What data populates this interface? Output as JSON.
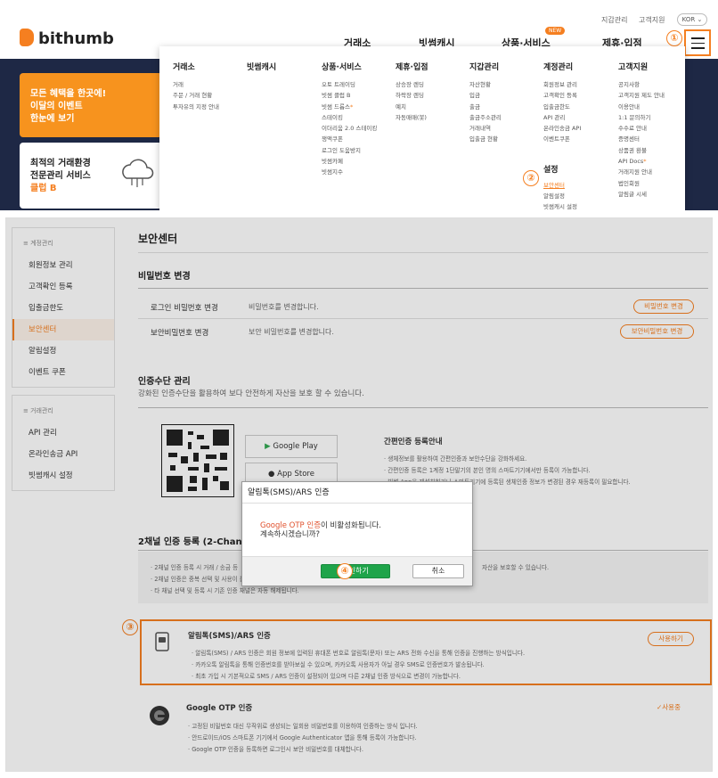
{
  "header": {
    "logo": "bithumb",
    "top_links": [
      "지갑관리",
      "고객지원"
    ],
    "lang": "KOR ⌄",
    "nav": [
      "거래소",
      "빗썸캐시",
      "상품·서비스",
      "제휴·입점"
    ],
    "new_badge": "NEW"
  },
  "markers": {
    "m1": "①",
    "m2": "②",
    "m3": "③",
    "m4": "④"
  },
  "banner": {
    "card1": [
      "모든 혜택을 한곳에!",
      "이달의 이벤트",
      "한눈에 보기"
    ],
    "card2": [
      "최적의 거래환경",
      "전문관리 서비스",
      "클럽 B"
    ]
  },
  "megamenu": [
    {
      "title": "거래소",
      "items": [
        "거래",
        "주문 / 거래 현황",
        "투자유의 지정 안내"
      ]
    },
    {
      "title": "빗썸캐시",
      "items": []
    },
    {
      "title": "상품·서비스",
      "items": [
        "오토 트레이딩",
        "빗썸 클럽 B",
        "빗썸 드롭스",
        "스테이킹",
        "이더리움 2.0 스테이킹",
        "쟁액쿠폰",
        "로그인 도움방지",
        "빗썸카페",
        "빗썸지수"
      ]
    },
    {
      "title": "제휴·입점",
      "items": [
        "상승장 렌딩",
        "하락장 렌딩",
        "예치",
        "자동매매(봇)"
      ]
    },
    {
      "title": "지갑관리",
      "items": [
        "자산현황",
        "입금",
        "출금",
        "출금주소관리",
        "거래내역",
        "입출금 현황"
      ]
    },
    {
      "title": "계정관리",
      "items": [
        "회원정보 관리",
        "고객확인 등록",
        "입출금한도",
        "API 관리",
        "온라인송금 API",
        "이벤트쿠폰"
      ],
      "sub_title": "설정",
      "sub_items": [
        "보안센터",
        "알림설정",
        "빗썸캐시 설정"
      ]
    },
    {
      "title": "고객지원",
      "items": [
        "공지사항",
        "고객지원 제도 안내",
        "이용안내",
        "1:1 문의하기",
        "수수료 안내",
        "증명센터",
        "상품권 환불",
        "API Docs",
        "거래지원 안내",
        "법인회원",
        "알림글 시세"
      ]
    }
  ],
  "sidebar": {
    "group1": {
      "title": "≡ 계정관리",
      "items": [
        "회원정보 관리",
        "고객확인 등록",
        "입출금한도",
        "보안센터",
        "알림설정",
        "이벤트 쿠폰"
      ]
    },
    "group2": {
      "title": "≡ 거래관리",
      "items": [
        "API 관리",
        "온라인송금 API",
        "빗썸캐시 설정"
      ]
    }
  },
  "page": {
    "title": "보안센터",
    "password": {
      "title": "비밀번호 변경",
      "rows": [
        {
          "label": "로그인 비밀번호 변경",
          "desc": "비밀번호를 변경합니다.",
          "btn": "비밀번호 변경"
        },
        {
          "label": "보안비밀번호 변경",
          "desc": "보안 비밀번호를 변경합니다.",
          "btn": "보안비밀번호 변경"
        }
      ]
    },
    "auth": {
      "title": "인증수단 관리",
      "desc": "강화된 인증수단을 활용하여 보다 안전하게 자산을 보호 할 수 있습니다.",
      "google_play": "Google Play",
      "app_store": "App Store",
      "easy_title": "간편인증 등록안내",
      "easy_bullets": [
        "· 생체정보를 활용하여 간편인증과 보안수단을 강화하세요.",
        "· 간편인증 등록은 1계정 1단말기의 본인 명의 스마트기기에서만 등록이 가능합니다.",
        "· 빗썸 App을 재설치하거나 스마트기기에 등록된 생체인증 정보가 변경된 경우 재등록이 필요합니다."
      ]
    },
    "twofactor": {
      "title": "2채널 인증 등록 (2-Channel V",
      "bullets": [
        "· 2채널 인증 등록 시 거래 / 송금 등",
        "· 2채널 인증은 중복 선택 및 사용이 불",
        "· 타 채널 선택 및 등록 시 기존 인증 채널은 자동 해제됩니다."
      ],
      "bullet_tail": "자산을 보호할 수 있습니다."
    },
    "sms": {
      "title": "알림톡(SMS)/ARS 인증",
      "btn": "사용하기",
      "bullets": [
        "· 알림톡(SMS) / ARS 인증은 회원 정보에 입력된 휴대폰 번호로 알림톡(문자) 또는 ARS 전화 수신을 통해 인증을 진행하는 방식입니다.",
        "· 카카오톡 알림톡을 통해 인증번호를 받아보실 수 있으며, 카카오톡 사용자가 아닐 경우 SMS로 인증번호가 발송됩니다.",
        "· 최초 가입 시 기본적으로 SMS / ARS 인증이 설정되어 있으며 다른 2채널 인증 방식으로 변경이 가능합니다."
      ]
    },
    "otp": {
      "title": "Google OTP 인증",
      "status": "✓사용중",
      "bullets": [
        "· 고정된 비밀번호 대신 무작위로 생성되는 일회용 비밀번호를 이용하여 인증하는 방식 입니다.",
        "· 안드로이드/iOS 스마트폰 기기에서 Google Authenticator 앱을 통해 등록이 가능합니다.",
        "· Google OTP 인증을 등록하면 로그인시 보안 비밀번호를 대체합니다."
      ]
    }
  },
  "dialog": {
    "title": "알림톡(SMS)/ARS 인증",
    "msg_highlight": "Google OTP 인증",
    "msg_rest": "이 비활성화됩니다.",
    "msg_line2": "계속하시겠습니까?",
    "confirm": "승인하기",
    "cancel": "취소"
  },
  "colors": {
    "accent": "#f57f20",
    "navy": "#1e2845"
  }
}
